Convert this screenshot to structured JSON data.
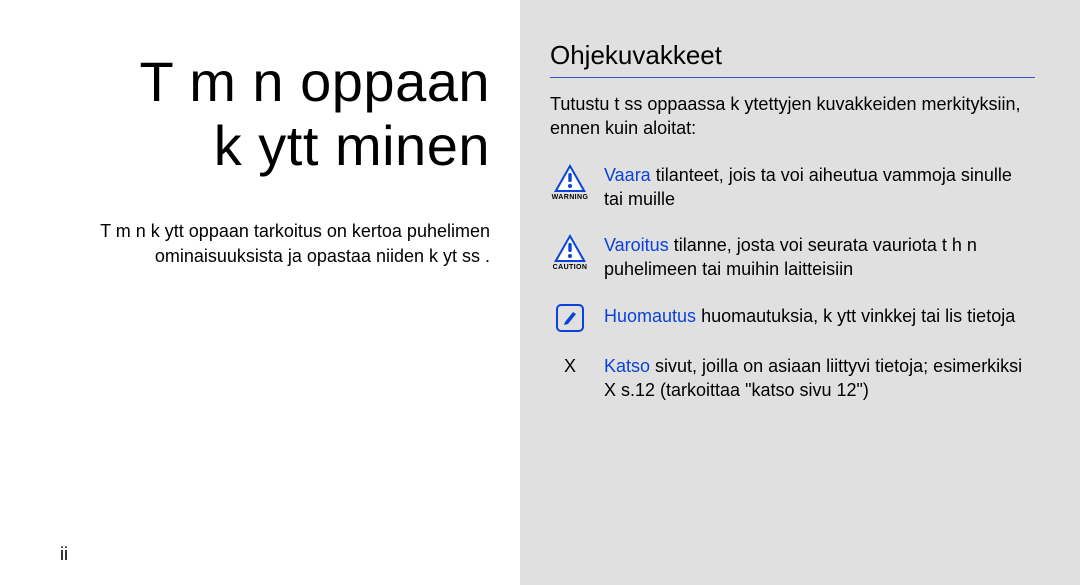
{
  "left": {
    "title_line1": "T m n oppaan",
    "title_line2": "k ytt minen",
    "desc": "T m n k ytt oppaan tarkoitus on kertoa puhelimen ominaisuuksista ja opastaa niiden k yt ss .",
    "page_number": "ii"
  },
  "right": {
    "heading": "Ohjekuvakkeet",
    "intro": "Tutustu t ss  oppaassa k ytettyjen kuvakkeiden merkityksiin, ennen kuin aloitat:",
    "entries": [
      {
        "icon": "warning",
        "icon_caption": "WARNING",
        "term": "Vaara",
        "sep": "   ",
        "desc": "tilanteet, jois ta voi aiheutua vammoja sinulle tai muille"
      },
      {
        "icon": "caution",
        "icon_caption": "CAUTION",
        "term": "Varoitus",
        "sep": "   ",
        "desc": "tilanne, josta voi seurata vauriota t h n puhelimeen tai muihin laitteisiin"
      },
      {
        "icon": "note",
        "icon_caption": "",
        "term": "Huomautus",
        "sep": "   ",
        "desc": "huomautuksia, k ytt vinkkej  tai lis tietoja"
      },
      {
        "icon": "xref",
        "icon_text": "X",
        "term": "Katso",
        "sep": "   ",
        "desc": "sivut, joilla on asiaan liittyvi  tietoja; esimerkiksi X s.12 (tarkoittaa \"katso sivu 12\")"
      }
    ]
  }
}
